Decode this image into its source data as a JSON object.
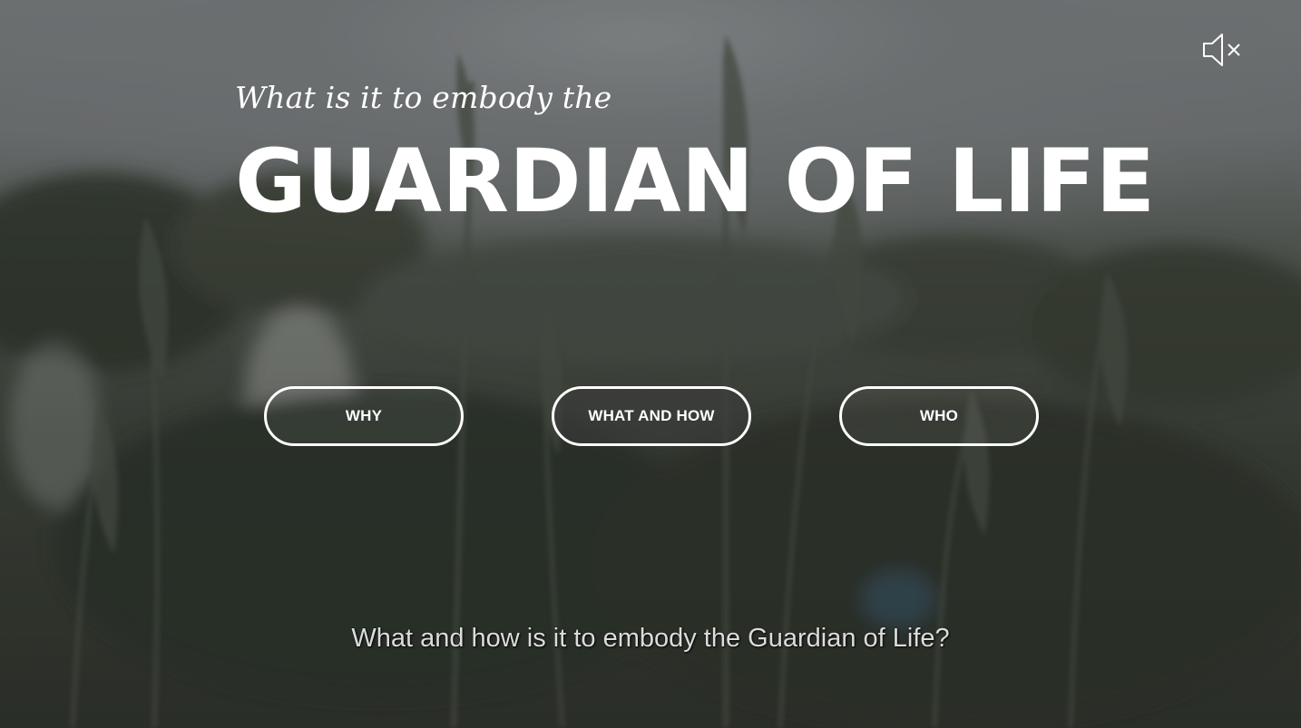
{
  "hero": {
    "kicker": "What is it to embody the",
    "title": "GUARDIAN OF LIFE"
  },
  "audio": {
    "icon": "speaker-muted-icon",
    "muted": true
  },
  "nav": {
    "buttons": [
      {
        "label": "WHY",
        "active": false
      },
      {
        "label": "WHAT AND HOW",
        "active": true
      },
      {
        "label": "WHO",
        "active": false
      }
    ]
  },
  "video": {
    "subtitle": "What and how is it to embody the Guardian of Life?"
  },
  "colors": {
    "text": "#ffffff",
    "button_border": "#ffffff",
    "subtitle": "#dcdcdc"
  }
}
